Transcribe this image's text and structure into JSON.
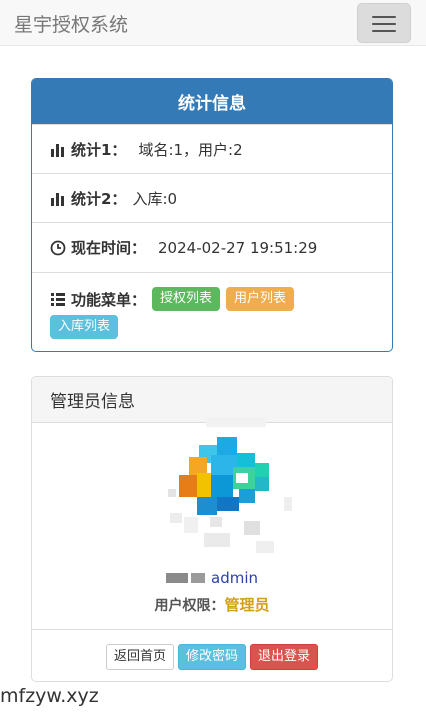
{
  "navbar": {
    "brand": "星宇授权系统",
    "menu_icon": "hamburger-menu-icon"
  },
  "stats_panel": {
    "title": "统计信息",
    "stat1": {
      "icon": "bar-chart-icon",
      "label": "统计1：",
      "value": "域名:1，用户:2"
    },
    "stat2": {
      "icon": "bar-chart-icon",
      "label": "统计2：",
      "value": "入库:0"
    },
    "time": {
      "icon": "clock-icon",
      "label": "现在时间：",
      "value": "2024-02-27 19:51:29"
    },
    "menu": {
      "icon": "list-icon",
      "label": "功能菜单：",
      "items": [
        {
          "label": "授权列表",
          "color": "#5cb85c"
        },
        {
          "label": "用户列表",
          "color": "#f0ad4e"
        },
        {
          "label": "入库列表",
          "color": "#5bc0de"
        }
      ]
    }
  },
  "admin_panel": {
    "title": "管理员信息",
    "username_value": "admin",
    "role_label": "用户权限：",
    "role_value": "管理员",
    "buttons": {
      "home": "返回首页",
      "change_password": "修改密码",
      "logout": "退出登录"
    }
  },
  "footer": {
    "site": "mfzyw.xyz"
  },
  "colors": {
    "primary": "#337ab7",
    "link": "#2a3fb0",
    "role": "#d4a017"
  }
}
